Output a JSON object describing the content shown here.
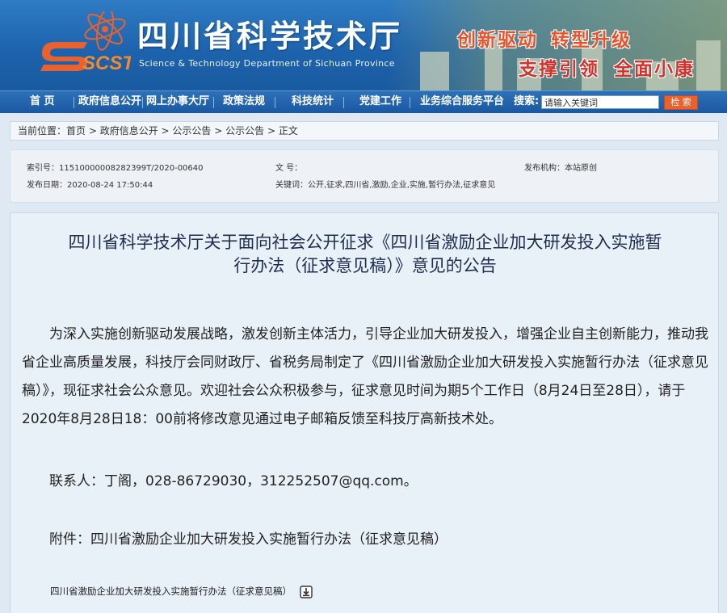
{
  "header": {
    "title": "四川省科学技术厅",
    "subtitle": "Science & Technology Department of Sichuan Province",
    "logo_text": "SCST",
    "slogans": [
      "创新驱动",
      "转型升级",
      "支撑引领",
      "全面小康"
    ]
  },
  "nav": {
    "items": [
      "首 页",
      "政府信息公开",
      "网上办事大厅",
      "政策法规",
      "科技统计",
      "党建工作",
      "业务综合服务平台"
    ],
    "search_label": "搜索:",
    "search_placeholder": "请输入关键词",
    "search_button": "检 索"
  },
  "breadcrumb": {
    "prefix": "当前位置：",
    "items": [
      "首页",
      "政府信息公开",
      "公示公告",
      "公示公告",
      "正文"
    ],
    "separator": " > "
  },
  "meta": {
    "index_no": "索引号：11510000008282399T/2020-00640",
    "doc_no": "文  号：",
    "publisher": "发布机构：本站原创",
    "publish_date": "发布日期：2020-08-24 17:50:44",
    "keywords": "关键词：公开,征求,四川省,激励,企业,实施,暂行办法,征求意见"
  },
  "article": {
    "title_line1": "四川省科学技术厅关于面向社会公开征求《四川省激励企业加大研发投入实施暂",
    "title_line2": "行办法（征求意见稿）》意见的公告",
    "paragraph": "为深入实施创新驱动发展战略，激发创新主体活力，引导企业加大研发投入，增强企业自主创新能力，推动我省企业高质量发展，科技厅会同财政厅、省税务局制定了《四川省激励企业加大研发投入实施暂行办法（征求意见稿）》，现征求社会公众意见。欢迎社会公众积极参与，征求意见时间为期5个工作日（8月24日至28日），请于2020年8月28日18：00前将修改意见通过电子邮箱反馈至科技厅高新技术处。",
    "contact": "联系人：丁阁，028-86729030，312252507@qq.com。",
    "attachment_intro": "附件：四川省激励企业加大研发投入实施暂行办法（征求意见稿）",
    "attachment_link": "四川省激励企业加大研发投入实施暂行办法（征求意见稿）"
  },
  "colors": {
    "header_blue": "#1d63ad",
    "slogan_orange": "#e8532b",
    "search_button": "#e8622f",
    "page_bg": "#dfe9f4"
  }
}
